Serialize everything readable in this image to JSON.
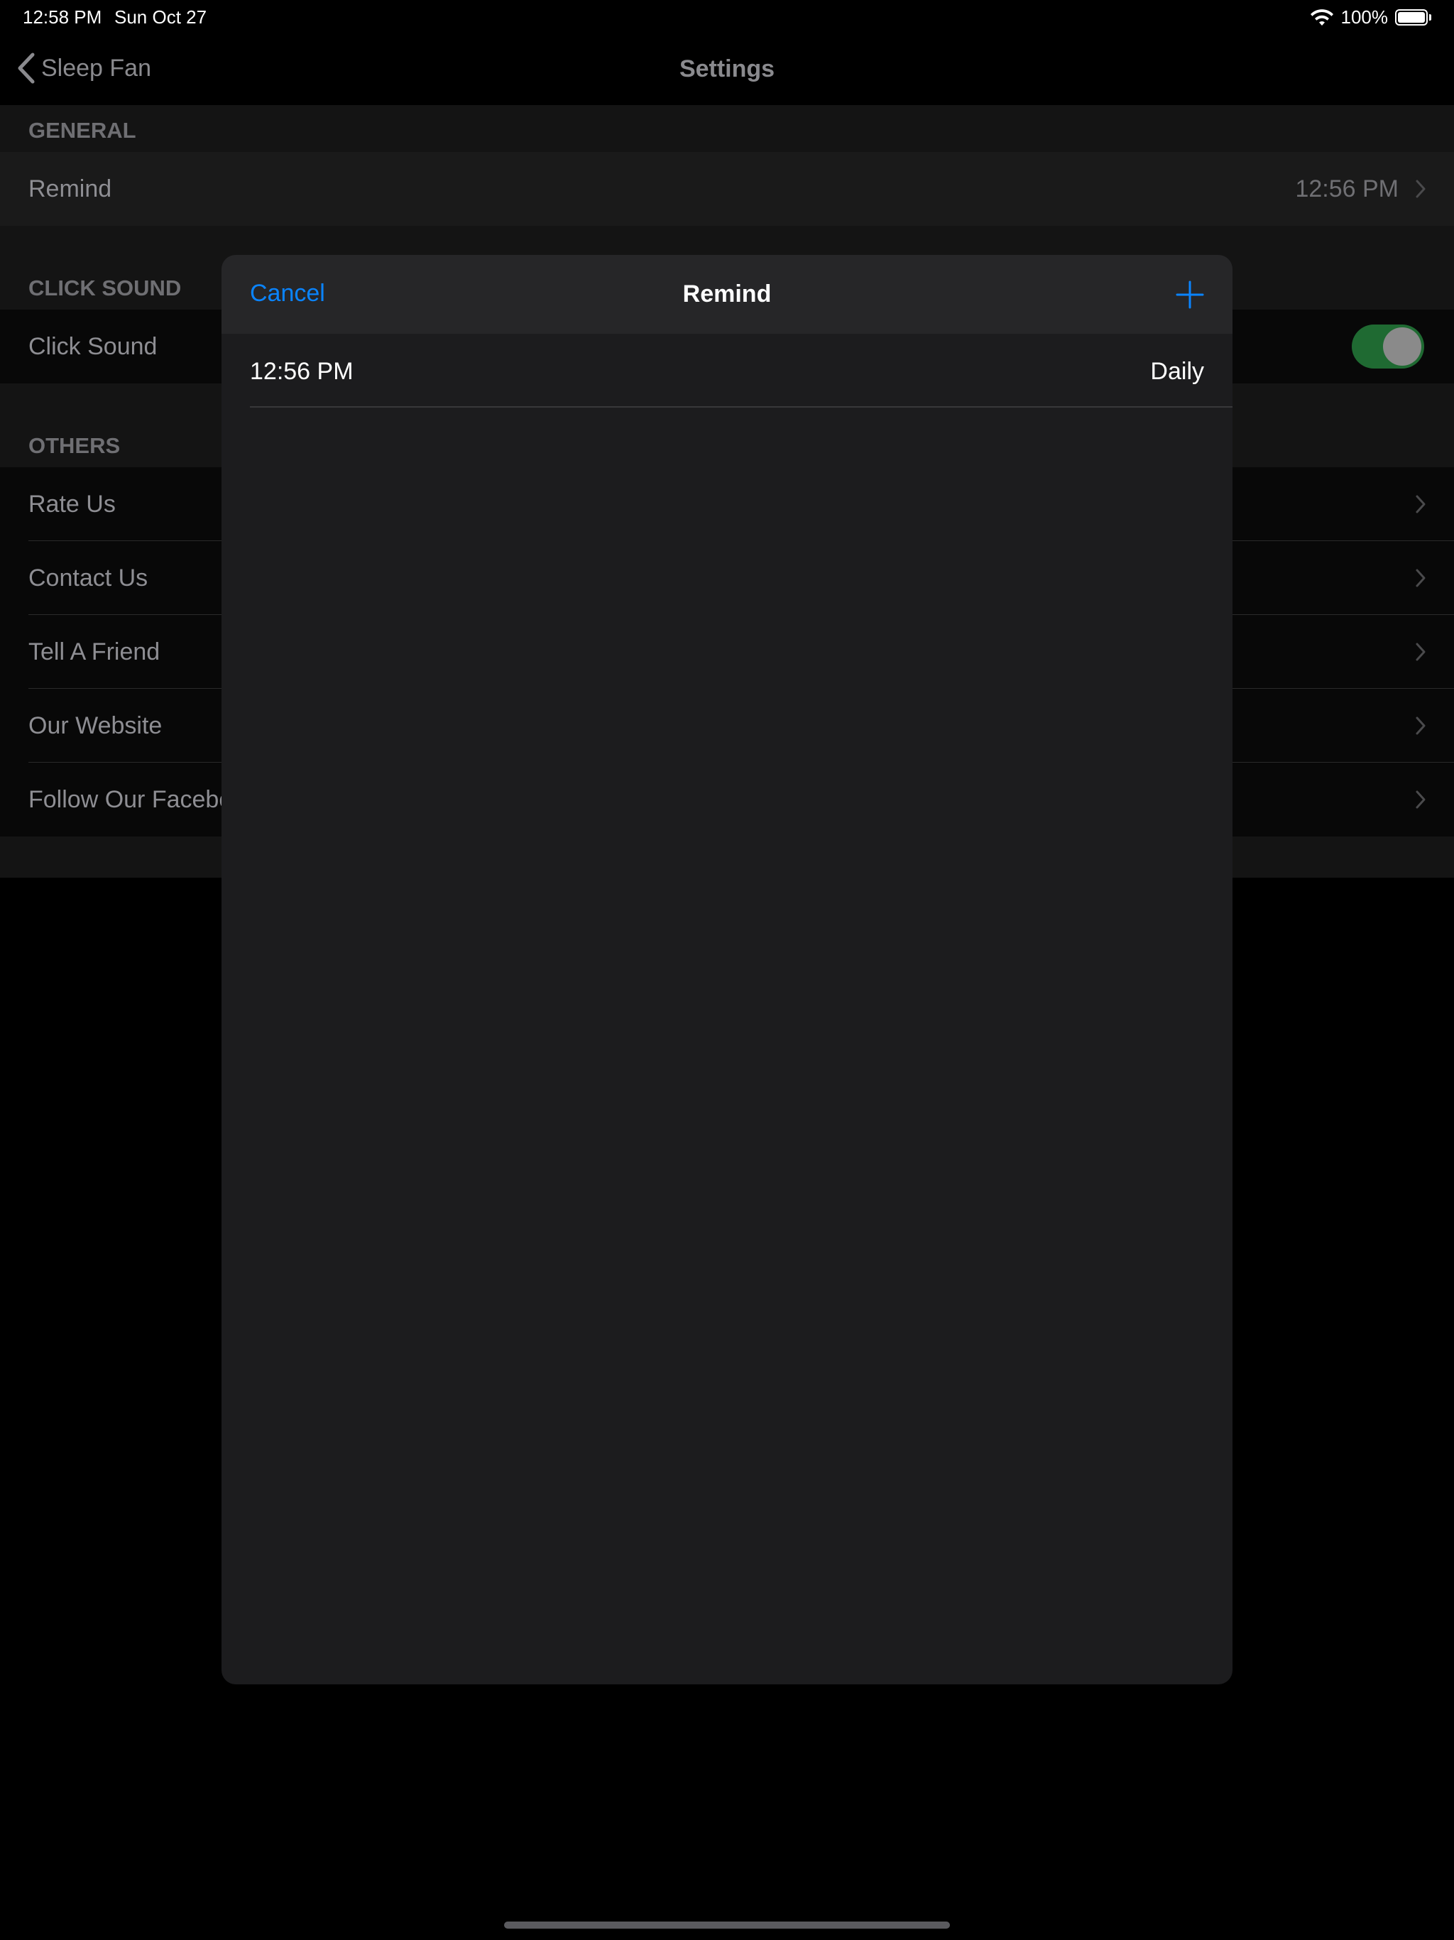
{
  "status_bar": {
    "time": "12:58 PM",
    "date": "Sun Oct 27",
    "battery": "100%",
    "battery_level": 1.0
  },
  "nav": {
    "back_label": "Sleep Fan",
    "title": "Settings"
  },
  "settings": {
    "general": {
      "header": "GENERAL",
      "remind_label": "Remind",
      "remind_value": "12:56 PM"
    },
    "click_sound": {
      "header": "CLICK SOUND",
      "label": "Click Sound",
      "enabled": true
    },
    "others": {
      "header": "OTHERS",
      "items": [
        {
          "label": "Rate Us"
        },
        {
          "label": "Contact Us"
        },
        {
          "label": "Tell A Friend"
        },
        {
          "label": "Our Website"
        },
        {
          "label": "Follow Our Facebo"
        }
      ]
    }
  },
  "sheet": {
    "cancel_label": "Cancel",
    "title": "Remind",
    "add_icon": "plus-icon",
    "reminders": [
      {
        "time": "12:56 PM",
        "repeat": "Daily"
      }
    ]
  },
  "colors": {
    "accent": "#0a84ff",
    "toggle_on": "#1f6a32",
    "sheet_bg": "#1c1c1e"
  }
}
